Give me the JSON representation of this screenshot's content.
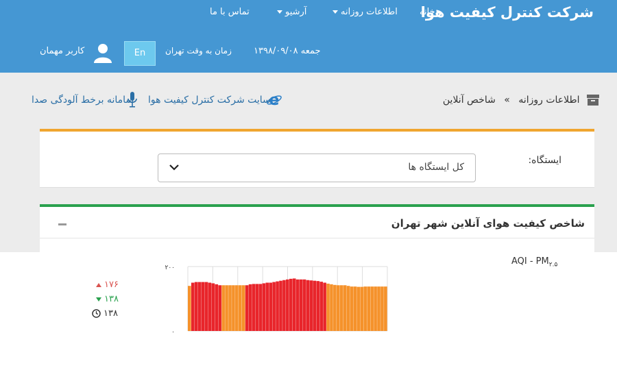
{
  "header": {
    "brand": "شرکت کنترل کیفیت هوا",
    "nav": {
      "home": "خانه",
      "daily": "اطلاعات روزانه",
      "archive": "آرشیو",
      "contact": "تماس با ما"
    },
    "date": "جمعه ۱۳۹۸/۰۹/۰۸",
    "time_label": "زمان به وقت تهران",
    "lang_button": "En",
    "user": "کاربر مهمان"
  },
  "breadcrumb": {
    "parent": "اطلاعات روزانه",
    "separator": "»",
    "current": "شاخص آنلاین"
  },
  "links": {
    "site": "سایت شرکت کنترل کیفیت هوا",
    "noise": "سامانه برخط آلودگی صدا"
  },
  "station": {
    "label": "ایستگاه:",
    "selected": "کل ایستگاه ها"
  },
  "panel": {
    "title": "شاخص کیفیت هوای آنلاین شهر تهران"
  },
  "aqi": {
    "label": "AQI - PM",
    "label_sub": "۲.۵",
    "max": "۱۷۶",
    "min": "۱۳۸",
    "current": "۱۳۸"
  },
  "colors": {
    "header": "#4597d3",
    "orange": "#f5922b",
    "red": "#e8252b",
    "green": "#2aa14e"
  },
  "chart_data": {
    "type": "bar",
    "ylim": [
      0,
      200
    ],
    "ytick_labels": [
      "۰",
      "۲۰۰"
    ],
    "grid": true,
    "values": [
      140,
      150,
      152,
      152,
      152,
      152,
      150,
      148,
      145,
      142,
      142,
      142,
      142,
      142,
      142,
      142,
      142,
      142,
      145,
      146,
      146,
      146,
      148,
      150,
      150,
      152,
      154,
      156,
      158,
      160,
      162,
      163,
      160,
      160,
      160,
      158,
      157,
      156,
      155,
      153,
      150,
      147,
      145,
      143,
      142,
      142,
      142,
      140,
      138,
      138,
      137,
      137,
      138,
      138,
      138,
      138,
      138,
      138,
      138
    ],
    "colors": [
      "orange",
      "red",
      "red",
      "red",
      "red",
      "red",
      "red",
      "red",
      "red",
      "red",
      "orange",
      "orange",
      "orange",
      "orange",
      "orange",
      "orange",
      "orange",
      "red",
      "red",
      "red",
      "red",
      "red",
      "red",
      "red",
      "red",
      "red",
      "red",
      "red",
      "red",
      "red",
      "red",
      "red",
      "red",
      "red",
      "red",
      "red",
      "red",
      "red",
      "red",
      "red",
      "red",
      "orange",
      "orange",
      "orange",
      "orange",
      "orange",
      "orange",
      "orange",
      "orange",
      "orange",
      "orange",
      "orange",
      "orange",
      "orange",
      "orange",
      "orange",
      "orange",
      "orange",
      "orange"
    ]
  }
}
